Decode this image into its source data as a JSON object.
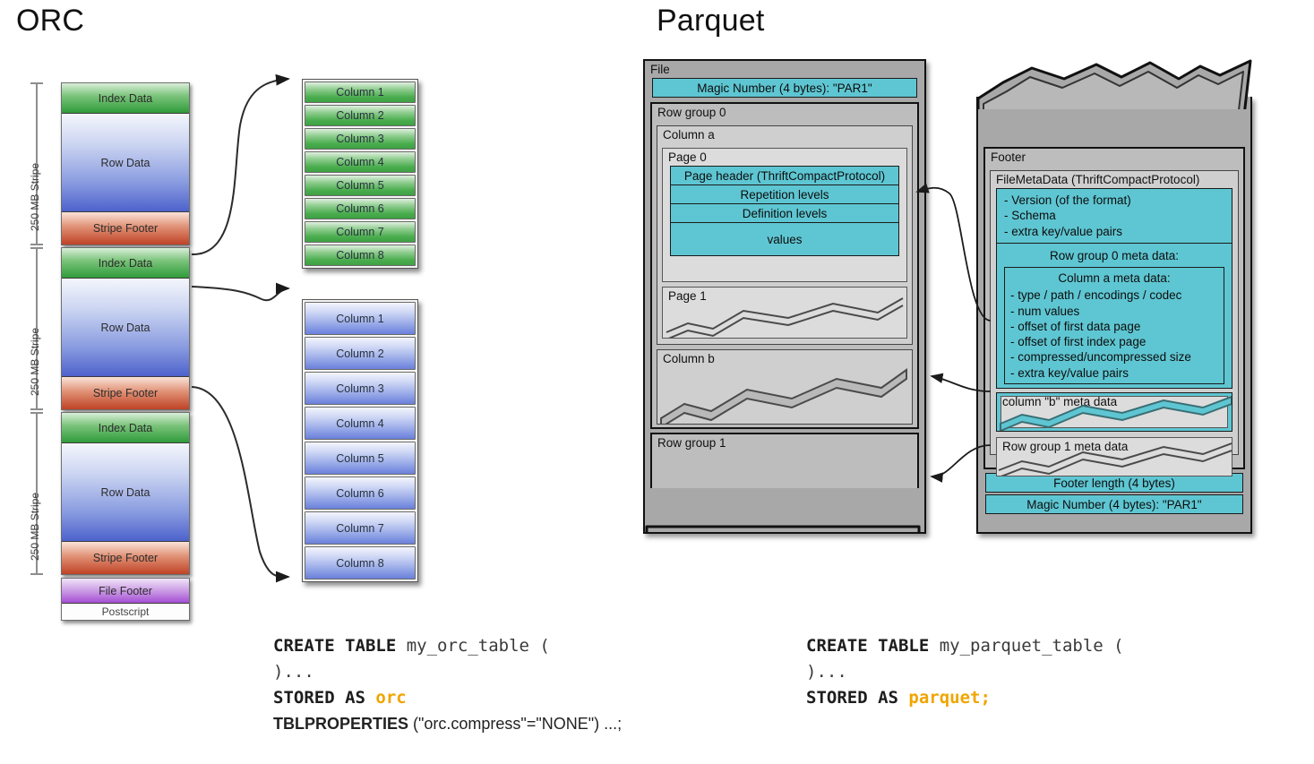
{
  "sections": {
    "orc_title": "ORC",
    "parquet_title": "Parquet"
  },
  "orc": {
    "stripe_ruler_label": "250 MB Stripe",
    "stripes": [
      {
        "bands": [
          {
            "name": "index",
            "label": "Index Data"
          },
          {
            "name": "row",
            "label": "Row Data"
          },
          {
            "name": "stripe_footer",
            "label": "Stripe Footer"
          }
        ]
      },
      {
        "bands": [
          {
            "name": "index",
            "label": "Index Data"
          },
          {
            "name": "row",
            "label": "Row Data"
          },
          {
            "name": "stripe_footer",
            "label": "Stripe Footer"
          }
        ]
      },
      {
        "bands": [
          {
            "name": "index",
            "label": "Index Data"
          },
          {
            "name": "row",
            "label": "Row Data"
          },
          {
            "name": "stripe_footer",
            "label": "Stripe Footer"
          }
        ]
      }
    ],
    "tail": [
      {
        "name": "file_footer",
        "label": "File Footer"
      },
      {
        "name": "postscript",
        "label": "Postscript"
      }
    ],
    "column_stacks": [
      {
        "color": "green",
        "columns": [
          "Column 1",
          "Column 2",
          "Column 3",
          "Column 4",
          "Column 5",
          "Column 6",
          "Column 7",
          "Column 8"
        ]
      },
      {
        "color": "blue",
        "columns": [
          "Column 1",
          "Column 2",
          "Column 3",
          "Column 4",
          "Column 5",
          "Column 6",
          "Column 7",
          "Column 8"
        ]
      }
    ]
  },
  "parquet": {
    "file_label": "File",
    "magic_top": "Magic Number (4 bytes): \"PAR1\"",
    "row_group_0_label": "Row group 0",
    "column_a_label": "Column a",
    "page0_label": "Page 0",
    "page0_rows": [
      "Page header (ThriftCompactProtocol)",
      "Repetition levels",
      "Definition levels",
      "values"
    ],
    "page1_label": "Page 1",
    "column_b_label": "Column b",
    "row_group_1_label": "Row group 1",
    "footer_label": "Footer",
    "filemetadata_label": "FileMetaData (ThriftCompactProtocol)",
    "filemetadata_items": [
      "- Version (of the format)",
      "- Schema",
      "- extra key/value pairs"
    ],
    "row_group_0_meta_label": "Row group 0 meta data:",
    "column_a_meta_label": "Column a meta data:",
    "column_a_meta_items": [
      "- type / path / encodings /  codec",
      "- num values",
      "- offset of first data page",
      "- offset of first index page",
      "- compressed/uncompressed size",
      "- extra key/value pairs"
    ],
    "column_b_meta_label": "column \"b\" meta data",
    "row_group_1_meta_label": "Row group 1 meta data",
    "footer_length": "Footer length (4 bytes)",
    "magic_bottom": "Magic Number (4 bytes): \"PAR1\""
  },
  "code": {
    "orc": {
      "l1_kw": "CREATE TABLE",
      "l1_rest": " my_orc_table (",
      "l2": ")...",
      "l3_kw": "STORED AS",
      "l3_lit": "orc",
      "l4_kw": "TBLPROPERTIES",
      "l4_rest": " (\"orc.compress\"=\"NONE\") ...;"
    },
    "parquet": {
      "l1_kw": "CREATE TABLE",
      "l1_rest": " my_parquet_table (",
      "l2": ")...",
      "l3_kw": "STORED AS",
      "l3_lit": "parquet;"
    }
  },
  "colors": {
    "teal": "#5ec6d2",
    "index_green": "#3a9b3f",
    "row_blue": "#4d62cc",
    "stripe_red": "#bf4326",
    "file_footer_purple": "#a44ed4",
    "code_literal": "#f0a500"
  }
}
